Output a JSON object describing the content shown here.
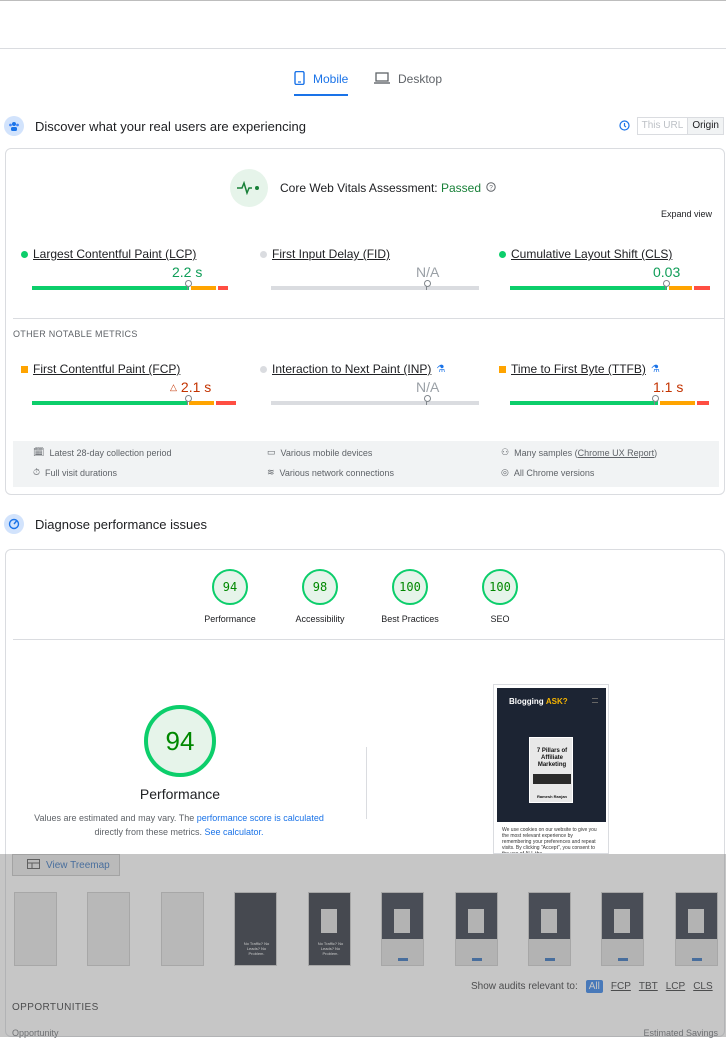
{
  "tabs": {
    "mobile": "Mobile",
    "desktop": "Desktop"
  },
  "field": {
    "title": "Discover what your real users are experiencing",
    "url_options": [
      "This URL",
      "Origin"
    ],
    "assessment_label": "Core Web Vitals Assessment:",
    "assessment_status": "Passed",
    "expand": "Expand view",
    "core_metrics": [
      {
        "name": "Largest Contentful Paint (LCP)",
        "value": "2.2 s",
        "status": "good",
        "bar": [
          0.75,
          0.12,
          0.05
        ]
      },
      {
        "name": "First Input Delay (FID)",
        "value": "N/A",
        "status": "na"
      },
      {
        "name": "Cumulative Layout Shift (CLS)",
        "value": "0.03",
        "status": "good",
        "bar": [
          0.75,
          0.12,
          0.08
        ]
      }
    ],
    "other_label": "OTHER NOTABLE METRICS",
    "other_metrics": [
      {
        "name": "First Contentful Paint (FCP)",
        "value": "2.1 s",
        "status": "needs-improvement"
      },
      {
        "name": "Interaction to Next Paint (INP)",
        "value": "N/A",
        "status": "na"
      },
      {
        "name": "Time to First Byte (TTFB)",
        "value": "1.1 s",
        "status": "needs-improvement"
      }
    ],
    "footer": {
      "period": "Latest 28-day collection period",
      "devices": "Various mobile devices",
      "samples": "Many samples (",
      "report": "Chrome UX Report",
      "samples_end": ")",
      "durations": "Full visit durations",
      "network": "Various network connections",
      "versions": "All Chrome versions"
    }
  },
  "lab": {
    "title": "Diagnose performance issues",
    "scores": [
      {
        "label": "Performance",
        "value": "94"
      },
      {
        "label": "Accessibility",
        "value": "98"
      },
      {
        "label": "Best Practices",
        "value": "100"
      },
      {
        "label": "SEO",
        "value": "100"
      }
    ],
    "big_score": "94",
    "big_label": "Performance",
    "note_pre": "Values are estimated and may vary. The ",
    "note_link1": "performance score is calculated",
    "note_mid": " directly from these metrics. ",
    "note_link2": "See calculator.",
    "screenshot": {
      "brand": "Blogging",
      "brand_accent": "ASK?",
      "book_title": "7 Pillars of Affiliate Marketing",
      "book_author": "Ramesh Ranjan",
      "cookie_text": "We use cookies on our website to give you the most relevant experience by remembering your preferences and repeat visits. By clicking \"Accept\", you consent to the use of ALL the"
    },
    "treemap": "View Treemap",
    "filmstrip_text": "No Traffic? No Leads? No Problem.",
    "show_audits": "Show audits relevant to:",
    "filters": [
      "All",
      "FCP",
      "TBT",
      "LCP",
      "CLS"
    ],
    "opportunities": "OPPORTUNITIES",
    "col_opportunity": "Opportunity",
    "col_savings": "Estimated Savings"
  },
  "colors": {
    "good": "#0cce6b",
    "average": "#ffa400",
    "poor": "#ff4e42",
    "accent": "#1a73e8"
  }
}
